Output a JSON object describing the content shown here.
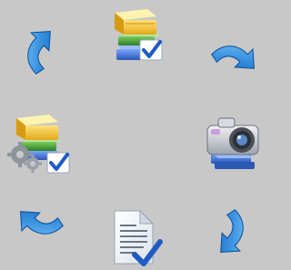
{
  "cycle": {
    "background": "#c8c8c8",
    "steps": [
      {
        "id": "top",
        "icon": "books-check-icon"
      },
      {
        "id": "right",
        "icon": "camera-books-icon"
      },
      {
        "id": "bottom",
        "icon": "document-check-icon"
      },
      {
        "id": "left",
        "icon": "books-gears-check-icon"
      }
    ],
    "arrows": [
      {
        "id": "top-left",
        "icon": "curved-arrow-icon",
        "direction": "up-right"
      },
      {
        "id": "top-right",
        "icon": "curved-arrow-icon",
        "direction": "down"
      },
      {
        "id": "bottom-right",
        "icon": "curved-arrow-icon",
        "direction": "left"
      },
      {
        "id": "bottom-left",
        "icon": "curved-arrow-icon",
        "direction": "up"
      }
    ],
    "colors": {
      "arrow_light": "#5fb0ea",
      "arrow_dark": "#0f5fb4",
      "book_yellow": "#f3c22b",
      "book_green": "#4d9f3c",
      "book_blue": "#3f6fd1",
      "check_blue": "#1f5bc4"
    }
  }
}
